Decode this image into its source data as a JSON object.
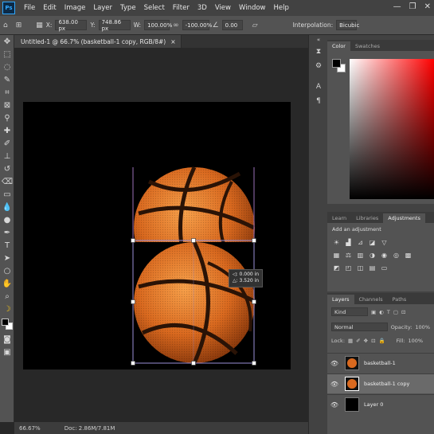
{
  "menubar": {
    "logo": "Ps",
    "items": [
      "File",
      "Edit",
      "Image",
      "Layer",
      "Type",
      "Select",
      "Filter",
      "3D",
      "View",
      "Window",
      "Help"
    ],
    "win_controls": [
      "—",
      "❐",
      "✕"
    ]
  },
  "options": {
    "x_label": "X:",
    "x_value": "638.00 px",
    "y_label": "Y:",
    "y_value": "748.86 px",
    "w_label": "W:",
    "w_value": "100.00%",
    "h_label": "H:",
    "h_value": "-100.00%",
    "angle_value": "0.00",
    "interp_label": "Interpolation:",
    "interp_value": "Bicubic"
  },
  "document": {
    "tab_title": "Untitled-1 @ 66.7% (basketball-1 copy, RGB/8#)",
    "tab_close": "×",
    "transform_tip_line1": "◁: 0.000 in",
    "transform_tip_line2": "△: 3.520 in"
  },
  "status": {
    "zoom": "66.67%",
    "doc_info": "Doc: 2.86M/7.81M"
  },
  "color_panel": {
    "tabs": [
      "Color",
      "Swatches"
    ],
    "foreground": "#000000",
    "background": "#ffffff",
    "hue": "#ff0000"
  },
  "adjust_panel": {
    "tabs": [
      "Learn",
      "Libraries",
      "Adjustments"
    ],
    "title": "Add an adjustment"
  },
  "layers_panel": {
    "tabs": [
      "Layers",
      "Channels",
      "Paths"
    ],
    "kind_placeholder": "Kind",
    "blend_mode": "Normal",
    "opacity_label": "Opacity:",
    "opacity_value": "100%",
    "lock_label": "Lock:",
    "fill_label": "Fill:",
    "fill_value": "100%",
    "layers": [
      {
        "name": "basketball-1",
        "selected": false
      },
      {
        "name": "basketball-1 copy",
        "selected": true
      },
      {
        "name": "Layer 0",
        "selected": false
      }
    ]
  },
  "accent": "#31a8ff"
}
